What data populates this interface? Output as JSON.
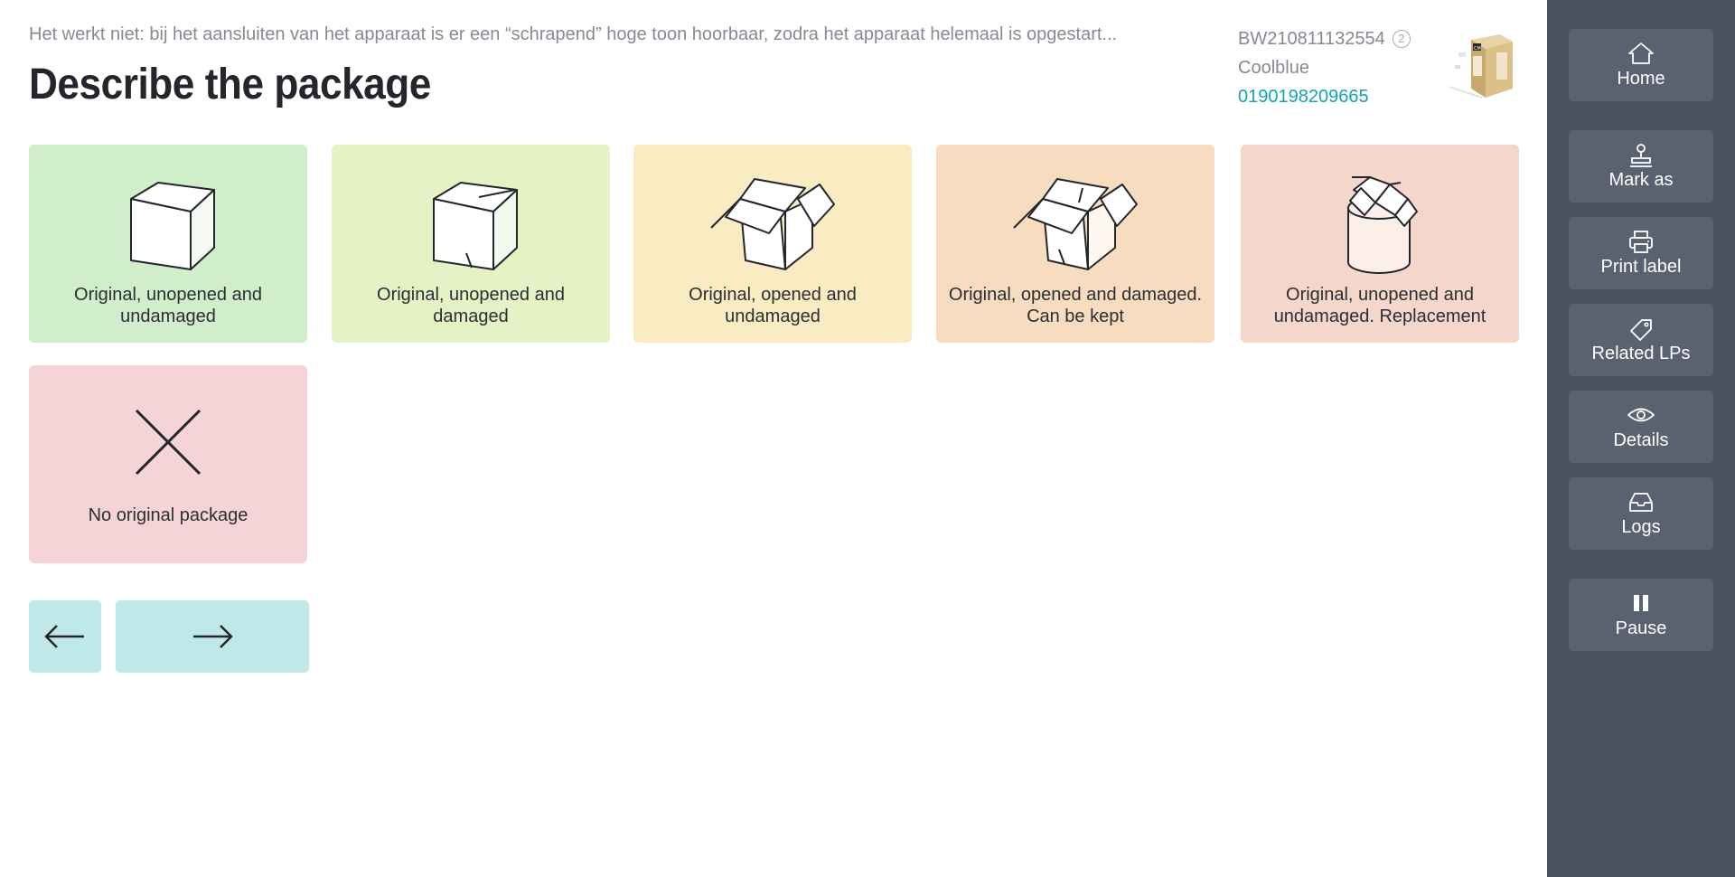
{
  "header": {
    "notice": "Het werkt niet: bij het aansluiten van het apparaat is er een “schrapend” hoge toon hoorbaar, zodra het apparaat helemaal is opgestart...",
    "title": "Describe the package",
    "code": "BW210811132554",
    "count": "2",
    "shop": "Coolblue",
    "ean": "0190198209665"
  },
  "options": [
    {
      "label": "Original, unopened and undamaged",
      "icon": "closed-box-icon",
      "color": "#d1eecb"
    },
    {
      "label": "Original, unopened and damaged",
      "icon": "damaged-box-icon",
      "color": "#e7f1c6"
    },
    {
      "label": "Original, opened and undamaged",
      "icon": "open-box-icon",
      "color": "#f9ecc3"
    },
    {
      "label": "Original, opened and damaged. Can be kept",
      "icon": "open-damaged-box-icon",
      "color": "#f8dcbf"
    },
    {
      "label": "Original, unopened and undamaged. Replacement",
      "icon": "bin-box-icon",
      "color": "#f5d6cb"
    },
    {
      "label": "No original package",
      "icon": "cross-icon",
      "color": "#f5d4d8"
    }
  ],
  "navigation": {
    "back": "arrow-left-icon",
    "next": "arrow-right-icon"
  },
  "sidebar": {
    "home": "Home",
    "mark_as": "Mark as",
    "print_label": "Print label",
    "related_lps": "Related LPs",
    "details": "Details",
    "logs": "Logs",
    "pause": "Pause"
  }
}
